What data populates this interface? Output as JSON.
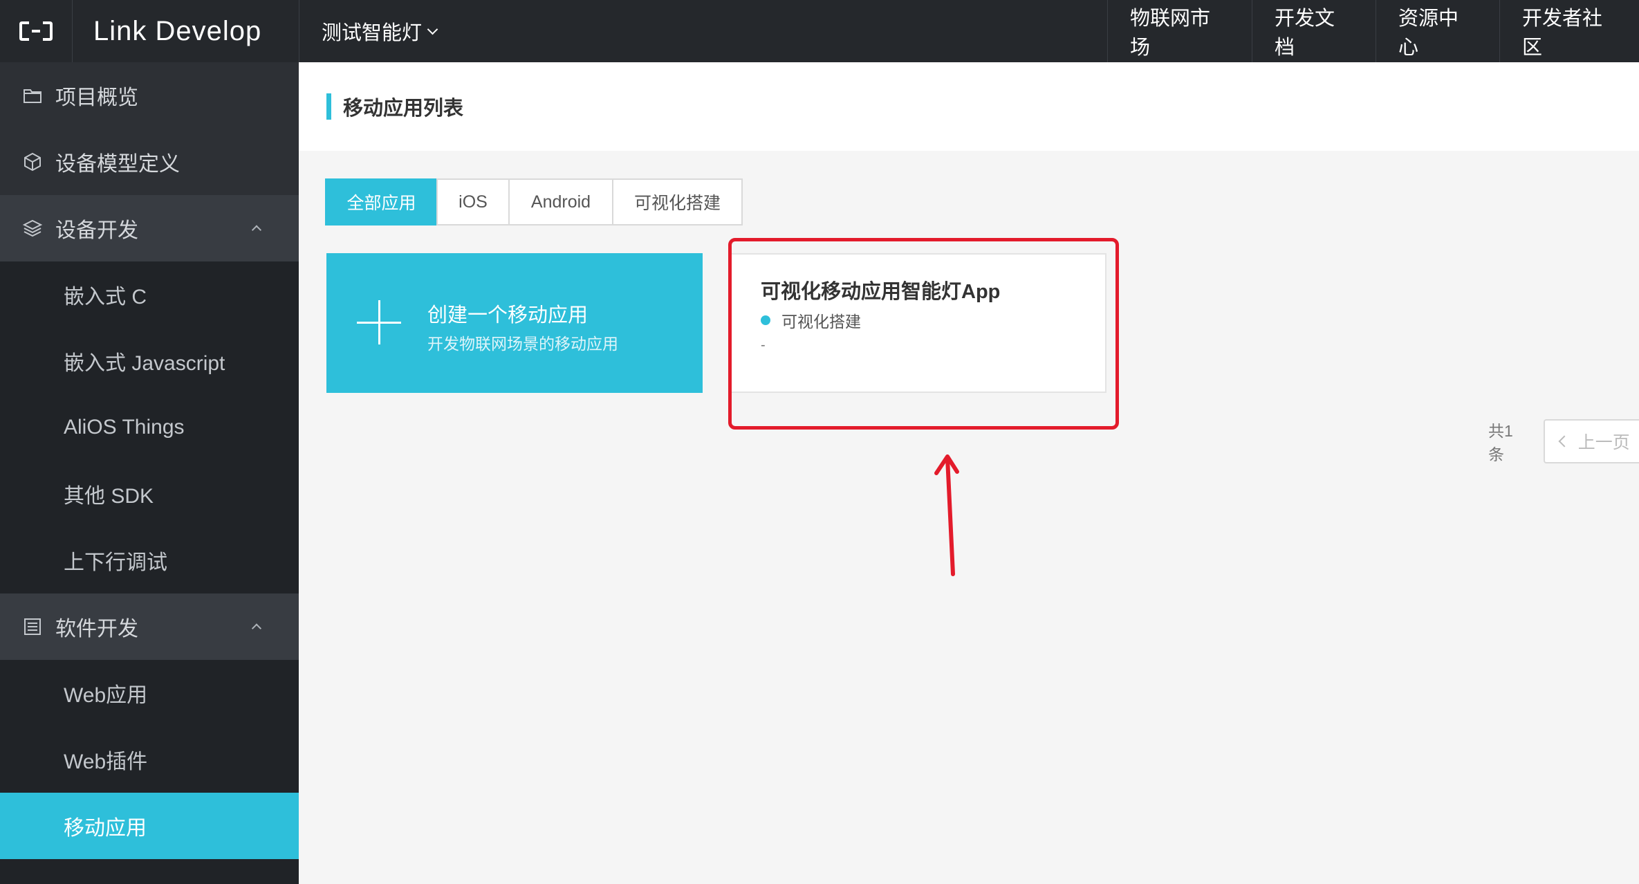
{
  "header": {
    "logo_icon": "alibaba-cloud-logo",
    "brand": "Link Develop",
    "project": "测试智能灯",
    "nav": [
      "物联网市场",
      "开发文档",
      "资源中心",
      "开发者社区"
    ]
  },
  "sidebar": {
    "items": [
      {
        "label": "项目概览",
        "icon": "folder-icon"
      },
      {
        "label": "设备模型定义",
        "icon": "cube-icon"
      },
      {
        "label": "设备开发",
        "icon": "layers-icon"
      },
      {
        "label": "嵌入式 C"
      },
      {
        "label": "嵌入式 Javascript"
      },
      {
        "label": "AliOS Things"
      },
      {
        "label": "其他 SDK"
      },
      {
        "label": "上下行调试"
      },
      {
        "label": "软件开发",
        "icon": "list-icon"
      },
      {
        "label": "Web应用"
      },
      {
        "label": "Web插件"
      },
      {
        "label": "移动应用"
      }
    ]
  },
  "main": {
    "title": "移动应用列表",
    "tabs": [
      "全部应用",
      "iOS",
      "Android",
      "可视化搭建"
    ],
    "active_tab": "全部应用",
    "create_card": {
      "title": "创建一个移动应用",
      "subtitle": "开发物联网场景的移动应用"
    },
    "apps": [
      {
        "name": "可视化移动应用智能灯App",
        "type": "可视化搭建",
        "description": "-"
      }
    ],
    "pagination": {
      "total": "共1条",
      "prev": "上一页"
    }
  },
  "colors": {
    "accent": "#2ebfda",
    "topbar": "#25282c",
    "sidebar": "#2d3035",
    "annotation": "#e31b2b"
  }
}
